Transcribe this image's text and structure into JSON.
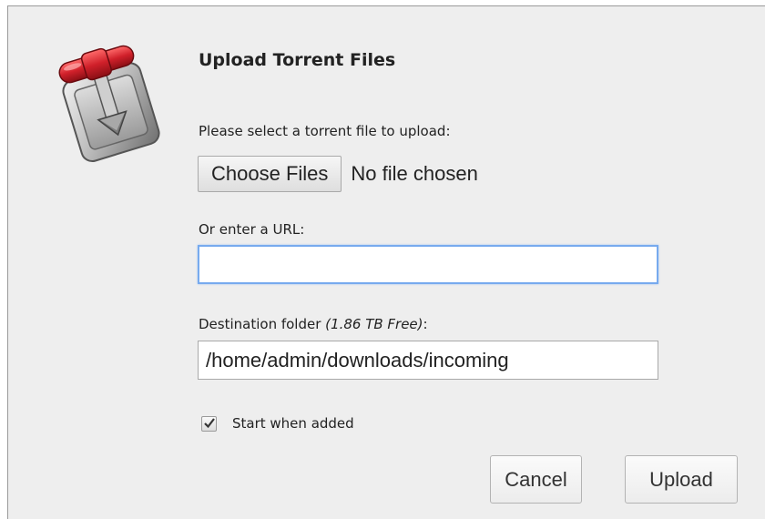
{
  "dialog": {
    "title": "Upload Torrent Files",
    "logo_icon": "transmission-logo-icon"
  },
  "file_select": {
    "label": "Please select a torrent file to upload:",
    "button_label": "Choose Files",
    "status": "No file chosen"
  },
  "url": {
    "label": "Or enter a URL:",
    "value": ""
  },
  "destination": {
    "label": "Destination folder",
    "free_space": "(1.86 TB Free)",
    "suffix": ":",
    "value": "/home/admin/downloads/incoming"
  },
  "start_when_added": {
    "label": "Start when added",
    "checked": true
  },
  "buttons": {
    "cancel": "Cancel",
    "upload": "Upload"
  },
  "colors": {
    "dialog_background": "#eeeeee",
    "focus_border": "#77aaee",
    "logo_red": "#c8202a"
  }
}
